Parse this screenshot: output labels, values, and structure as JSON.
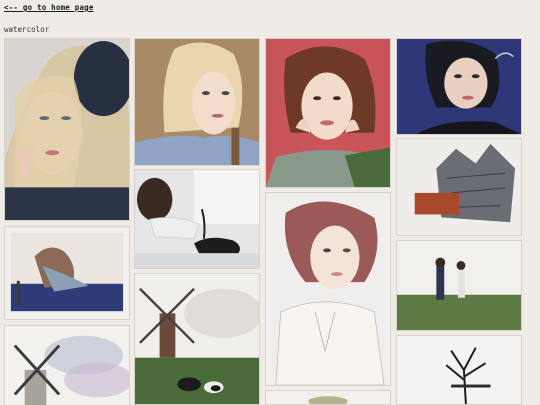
{
  "nav": {
    "home_link": "<-- go to home page"
  },
  "section": {
    "title": "watercolor"
  },
  "gallery": {
    "tiles": [
      "blonde-girl-beret-watercolor",
      "short-blonde-hair-portrait-watercolor",
      "girl-hands-on-cheeks-red-background-watercolor",
      "girl-smoking-blue-background-watercolor",
      "person-with-cat-watercolor",
      "auburn-haired-girl-watercolor",
      "floating-castle-watercolor",
      "girl-sitting-by-sea-watercolor",
      "windmill-cows-watercolor",
      "couple-walking-field-watercolor",
      "windmill-sky-watercolor",
      "bare-tree-watercolor"
    ]
  }
}
